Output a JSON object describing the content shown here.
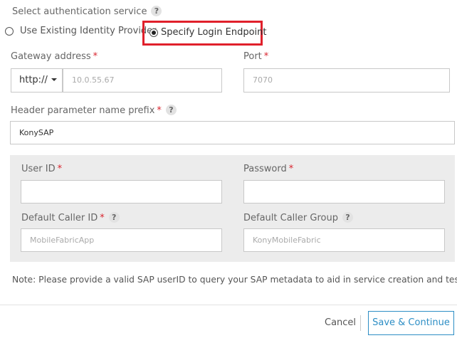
{
  "auth": {
    "title": "Select authentication service",
    "option_existing": "Use Existing Identity Provider",
    "option_endpoint": "Specify Login Endpoint",
    "selected": "Specify Login Endpoint"
  },
  "gateway": {
    "label": "Gateway address",
    "required": "*",
    "protocol": "http://",
    "placeholder": "10.0.55.67"
  },
  "port": {
    "label": "Port",
    "required": "*",
    "placeholder": "7070"
  },
  "header_prefix": {
    "label": "Header parameter name prefix",
    "required": "*",
    "value": "KonySAP"
  },
  "credentials": {
    "user_id_label": "User ID",
    "user_id_required": "*",
    "user_id_value": "",
    "password_label": "Password",
    "password_required": "*",
    "password_value": "",
    "caller_id_label": "Default Caller ID",
    "caller_id_required": "*",
    "caller_id_placeholder": "MobileFabricApp",
    "caller_group_label": "Default Caller Group",
    "caller_group_placeholder": "KonyMobileFabric"
  },
  "note": "Note: Please provide a valid SAP userID to query your SAP metadata to aid in service creation and testing.",
  "footer": {
    "cancel": "Cancel",
    "save": "Save & Continue"
  },
  "help_glyph": "?",
  "colors": {
    "accent": "#2d8ec5",
    "required": "#d9232d",
    "highlight": "#e0202b",
    "panel": "#ececec"
  }
}
